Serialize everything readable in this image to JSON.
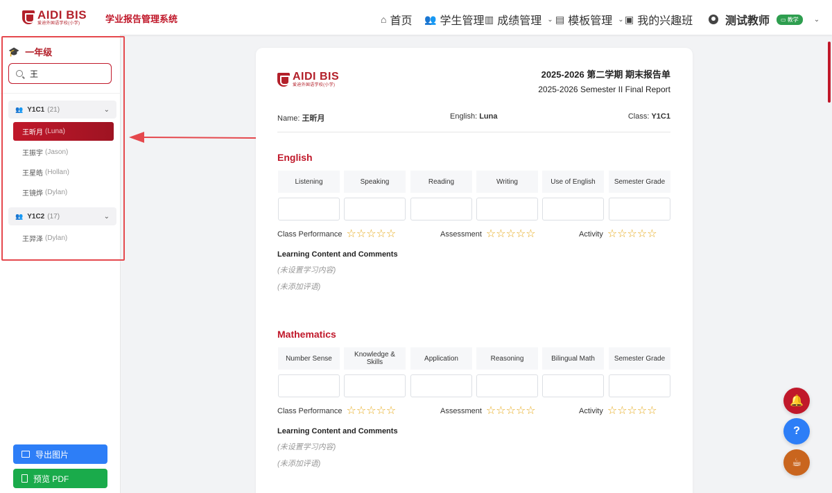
{
  "header": {
    "logo_title": "AIDI BIS",
    "logo_sub": "爱迪外国语学校(小学)",
    "app_title": "学业报告管理系统",
    "nav": {
      "home": "首页",
      "students": "学生管理",
      "grades": "成绩管理",
      "templates": "模板管理",
      "interest": "我的兴趣班",
      "user": "测试教师",
      "role_badge": "教学"
    }
  },
  "sidebar": {
    "grade_title": "一年级",
    "search_value": "王",
    "classes": [
      {
        "name": "Y1C1",
        "count": "(21)",
        "students": [
          {
            "cn": "王昕月",
            "en": "(Luna)",
            "active": true
          },
          {
            "cn": "王振宇",
            "en": "(Jason)"
          },
          {
            "cn": "王星皓",
            "en": "(Hollan)"
          },
          {
            "cn": "王镜烨",
            "en": "(Dylan)"
          }
        ]
      },
      {
        "name": "Y1C2",
        "count": "(17)",
        "students": [
          {
            "cn": "王羿泽",
            "en": "(Dylan)"
          }
        ]
      }
    ],
    "export_label": "导出图片",
    "pdf_label": "预览 PDF"
  },
  "report": {
    "logo_title": "AIDI BIS",
    "logo_sub": "爱迪外国语学校(小学)",
    "title_cn": "2025-2026 第二学期 期末报告单",
    "title_en": "2025-2026 Semester II Final Report",
    "name_label": "Name:",
    "name_value": "王昕月",
    "english_label": "English:",
    "english_value": "Luna",
    "class_label": "Class:",
    "class_value": "Y1C1",
    "subjects": [
      {
        "title": "English",
        "columns": [
          "Listening",
          "Speaking",
          "Reading",
          "Writing",
          "Use of English",
          "Semester Grade"
        ],
        "ratings": [
          "Class Performance",
          "Assessment",
          "Activity"
        ],
        "lc_title": "Learning Content and Comments",
        "lc_note1": "(未设置学习内容)",
        "lc_note2": "(未添加评语)"
      },
      {
        "title": "Mathematics",
        "columns": [
          "Number Sense",
          "Knowledge & Skills",
          "Application",
          "Reasoning",
          "Bilingual Math",
          "Semester Grade"
        ],
        "ratings": [
          "Class Performance",
          "Assessment",
          "Activity"
        ],
        "lc_title": "Learning Content and Comments",
        "lc_note1": "(未设置学习内容)",
        "lc_note2": "(未添加评语)"
      }
    ]
  },
  "colors": {
    "brand": "#c0182a",
    "highlight": "#e5484d",
    "export_btn": "#2d7ef7",
    "pdf_btn": "#1aab4b"
  }
}
